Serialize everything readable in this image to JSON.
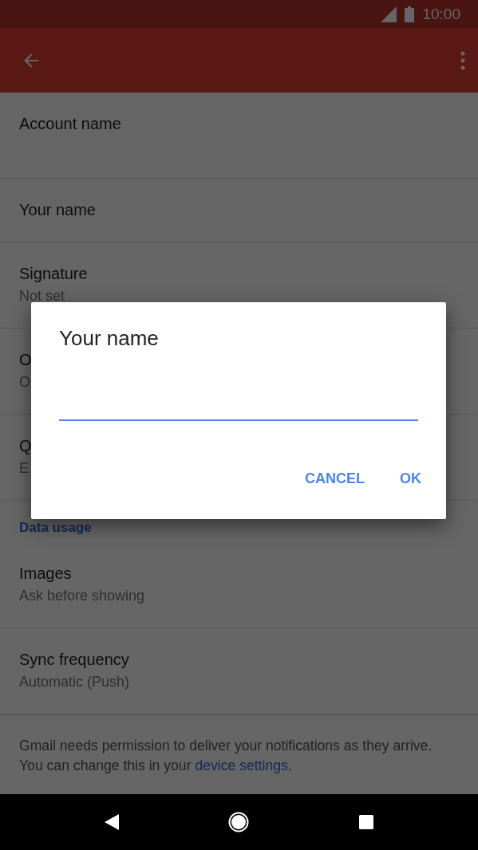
{
  "status_bar": {
    "time": "10:00"
  },
  "settings": [
    {
      "kind": "spaced",
      "title": "Account name"
    },
    {
      "kind": "item",
      "title": "Your name"
    },
    {
      "kind": "item",
      "title": "Signature",
      "subtitle": "Not set"
    },
    {
      "kind": "item",
      "title": "O",
      "subtitle": "O"
    },
    {
      "kind": "item",
      "title": "Q",
      "subtitle": "E"
    },
    {
      "kind": "header",
      "title": "Data usage"
    },
    {
      "kind": "item",
      "title": "Images",
      "subtitle": "Ask before showing"
    },
    {
      "kind": "item",
      "title": "Sync frequency",
      "subtitle": "Automatic (Push)"
    }
  ],
  "footer": {
    "text": "Gmail needs permission to deliver your notifications as they arrive. You can change this in your",
    "link": "device settings",
    "after": "."
  },
  "dialog": {
    "title": "Your name",
    "buttons": [
      "CANCEL",
      "OK"
    ]
  }
}
